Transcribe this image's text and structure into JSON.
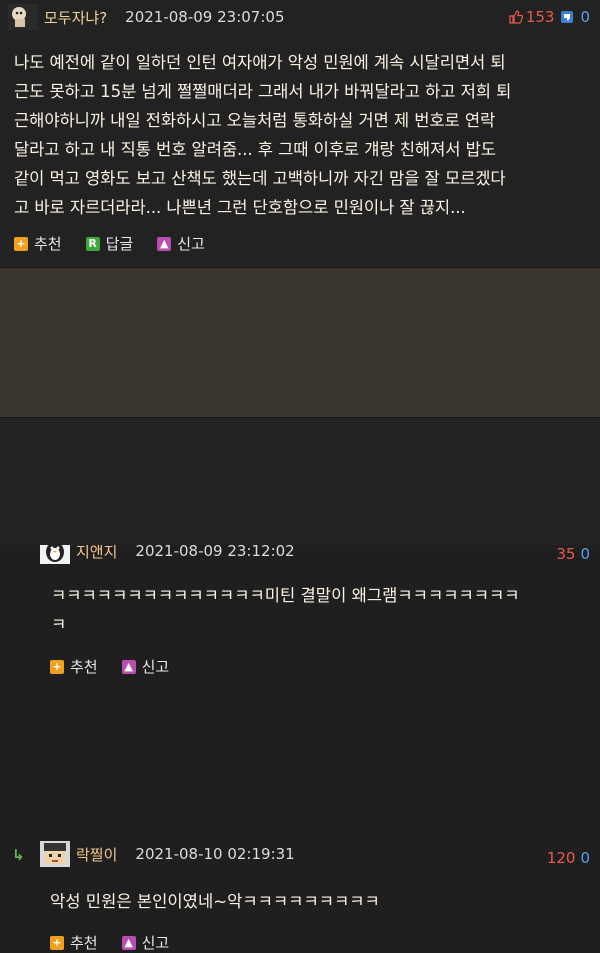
{
  "comments": [
    {
      "nickname": "모두자냐?",
      "date": "2021-08-09 23:07:05",
      "upvotes": "153",
      "downvotes": "0",
      "lines": [
        "나도 예전에 같이 일하던 인턴 여자애가 악성 민원에 계속 시달리면서 퇴",
        "근도 못하고 15분 넘게 쩔쩔매더라 그래서 내가 바꿔달라고 하고 저희 퇴",
        "근해야하니까 내일 전화하시고 오늘처럼 통화하실 거면 제 번호로 연락",
        "달라고 하고 내 직통 번호 알려줌... 후 그때 이후로 걔랑 친해져서 밥도",
        "같이 먹고 영화도 보고 산책도 했는데 고백하니까 자긴 맘을 잘 모르겠다",
        "고 바로 자르더라라... 나쁜년 그런 단호함으로 민원이나 잘 끊지..."
      ],
      "actions": {
        "recommend": "추천",
        "reply": "답글",
        "report": "신고"
      }
    },
    {
      "nickname": "지앤지",
      "date": "2021-08-09 23:12:02",
      "upvotes": "35",
      "downvotes": "0",
      "lines": [
        "ㅋㅋㅋㅋㅋㅋㅋㅋㅋㅋㅋㅋㅋㅋ미틴 결말이 왜그램ㅋㅋㅋㅋㅋㅋㅋㅋ",
        "ㅋ"
      ],
      "actions": {
        "recommend": "추천",
        "report": "신고"
      }
    },
    {
      "nickname": "락찔이",
      "date": "2021-08-10 02:19:31",
      "upvotes": "120",
      "downvotes": "0",
      "lines": [
        "악성 민원은 본인이였네~악ㅋㅋㅋㅋㅋㅋㅋㅋㅋ"
      ],
      "actions": {
        "recommend": "추천",
        "report": "신고"
      }
    }
  ],
  "icons": {
    "avatar_1": "cartoon-avatar-icon",
    "avatar_2": "penguin-avatar-icon",
    "avatar_3": "pixel-face-avatar-icon",
    "thumb_up": "thumb-up-icon",
    "thumb_down": "thumb-down-icon",
    "recommend": "plus-icon",
    "reply": "reply-r-icon",
    "report": "report-icon",
    "reply_arrow": "reply-arrow-icon"
  },
  "colors": {
    "upvote": "#e65b4b",
    "downvote": "#5aa0f0",
    "highlight_bg": "#3b3530",
    "recommend_icon": "#f0a01e",
    "reply_icon": "#3fa53f",
    "report_icon": "#b84fb0"
  }
}
